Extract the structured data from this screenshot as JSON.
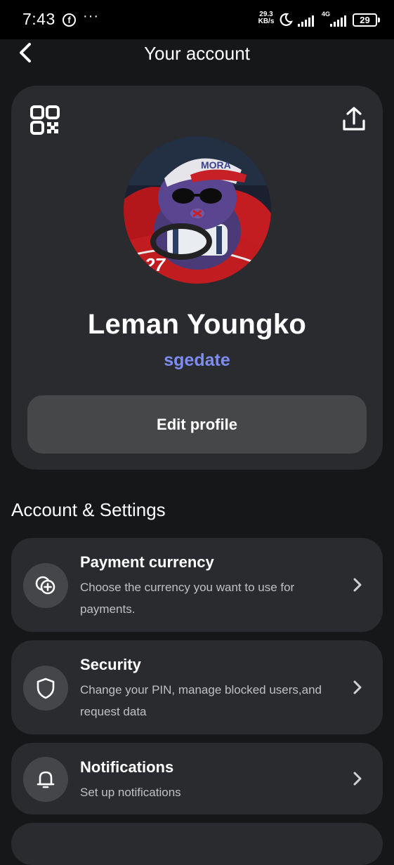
{
  "status_bar": {
    "time": "7:43",
    "fb_glyph": "f",
    "dots": "···",
    "speed_value": "29.3",
    "speed_unit": "KB/s",
    "lte": "4G",
    "battery": "29",
    "icons": [
      "facebook-icon",
      "moon-icon",
      "signal-icon",
      "battery-icon"
    ]
  },
  "header": {
    "title": "Your account",
    "back_icon": "chevron-left-icon"
  },
  "profile": {
    "qr_icon": "qr-code-icon",
    "share_icon": "share-icon",
    "name": "Leman Youngko",
    "username": "sgedate",
    "edit_label": "Edit profile",
    "avatar_cap_text": "MORA",
    "avatar_car_number": "27"
  },
  "settings": {
    "heading": "Account & Settings",
    "items": [
      {
        "title": "Payment currency",
        "desc": "Choose the currency you want to use for payments.",
        "icon": "currency-icon"
      },
      {
        "title": "Security",
        "desc": "Change your PIN, manage blocked users,and request data",
        "icon": "shield-icon"
      },
      {
        "title": "Notifications",
        "desc": "Set up notifications",
        "icon": "bell-icon"
      }
    ]
  },
  "colors": {
    "background": "#161719",
    "card": "#2a2b2e",
    "accent": "#7f8cf3",
    "button": "#464749"
  }
}
